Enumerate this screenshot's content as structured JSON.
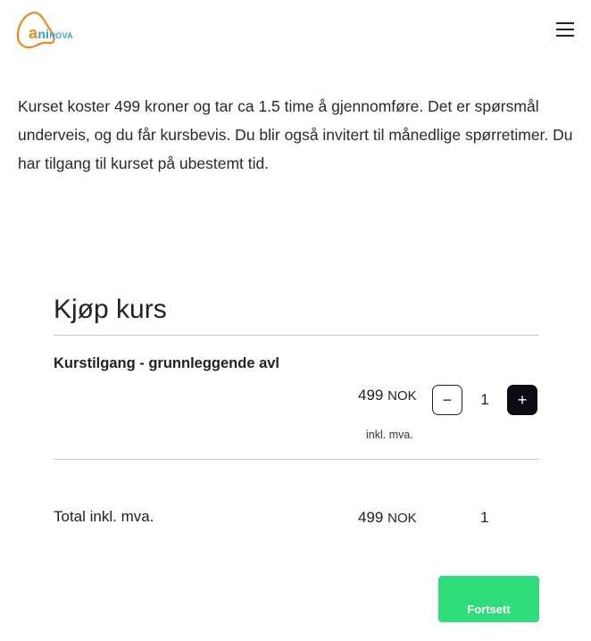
{
  "header": {
    "logo": {
      "part_a": "a",
      "part_ni": "ni",
      "part_nova": "NOVA"
    },
    "menu_icon": "hamburger-icon"
  },
  "intro": {
    "text": "Kurset koster 499 kroner og tar ca 1.5 time å gjennomføre. Det er spørsmål underveis, og du får kursbevis. Du blir også invitert til månedlige spørretimer. Du har tilgang til kurset på ubestemt tid."
  },
  "purchase": {
    "title": "Kjøp kurs",
    "product": {
      "name": "Kurstilgang - grunnleggende avl",
      "price": "499",
      "currency": "NOK",
      "vat_note": "inkl. mva.",
      "quantity": "1",
      "minus_label": "−",
      "plus_label": "+"
    },
    "total": {
      "label": "Total inkl. mva.",
      "price": "499",
      "currency": "NOK",
      "quantity": "1"
    },
    "continue_label": "Fortsett"
  },
  "colors": {
    "brand_orange": "#f08a1c",
    "brand_blue": "#2ea3d5",
    "continue_green": "#2edd79",
    "plus_button": "#0b0b12"
  }
}
